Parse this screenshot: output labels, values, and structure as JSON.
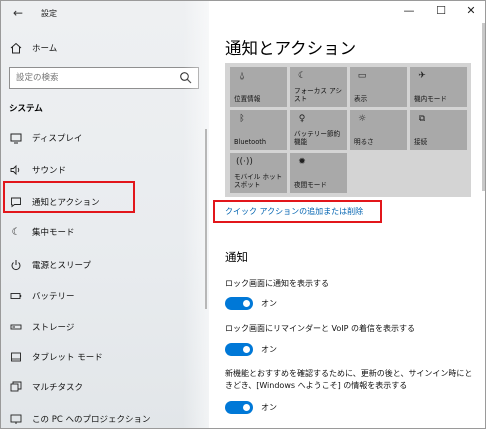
{
  "window": {
    "title": "設定",
    "controls": {
      "minimize": "—",
      "maximize": "☐",
      "close": "✕"
    }
  },
  "sidebar": {
    "home_label": "ホーム",
    "search_placeholder": "設定の検索",
    "section_title": "システム",
    "items": [
      {
        "label": "ディスプレイ",
        "icon": "display-icon"
      },
      {
        "label": "サウンド",
        "icon": "sound-icon"
      },
      {
        "label": "通知とアクション",
        "icon": "notification-icon"
      },
      {
        "label": "集中モード",
        "icon": "moon-icon"
      },
      {
        "label": "電源とスリープ",
        "icon": "power-icon"
      },
      {
        "label": "バッテリー",
        "icon": "battery-icon"
      },
      {
        "label": "ストレージ",
        "icon": "storage-icon"
      },
      {
        "label": "タブレット モード",
        "icon": "tablet-icon"
      },
      {
        "label": "マルチタスク",
        "icon": "multitask-icon"
      },
      {
        "label": "この PC へのプロジェクション",
        "icon": "projection-icon"
      }
    ]
  },
  "main": {
    "page_title": "通知とアクション",
    "quick_actions": [
      {
        "label": "位置情報",
        "icon": "location-icon"
      },
      {
        "label": "フォーカス アシスト",
        "icon": "moon-icon"
      },
      {
        "label": "表示",
        "icon": "display-icon"
      },
      {
        "label": "機内モード",
        "icon": "airplane-icon"
      },
      {
        "label": "Bluetooth",
        "icon": "bluetooth-icon"
      },
      {
        "label": "バッテリー節約機能",
        "icon": "battery-saver-icon"
      },
      {
        "label": "明るさ",
        "icon": "brightness-icon"
      },
      {
        "label": "接続",
        "icon": "connect-icon"
      },
      {
        "label": "モバイル ホットスポット",
        "icon": "hotspot-icon"
      },
      {
        "label": "夜間モード",
        "icon": "night-light-icon"
      }
    ],
    "quick_action_link": "クイック アクションの追加または削除",
    "notifications_heading": "通知",
    "settings": [
      {
        "label": "ロック画面に通知を表示する",
        "state": "オン"
      },
      {
        "label": "ロック画面にリマインダーと VoIP の着信を表示する",
        "state": "オン"
      },
      {
        "label": "新機能とおすすめを確認するために、更新の後と、サインイン時にときどき、[Windows へようこそ] の情報を表示する",
        "state": "オン"
      }
    ]
  },
  "colors": {
    "accent": "#0078d7",
    "link": "#0063b1",
    "highlight_box": "#e2161b",
    "tile_bg": "#a9a9a9",
    "tile_panel_bg": "#d4d4d4"
  }
}
